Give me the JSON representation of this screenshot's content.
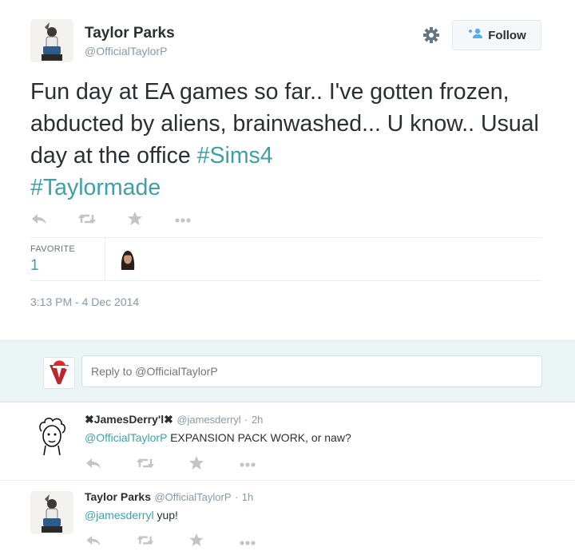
{
  "tweet": {
    "display_name": "Taylor Parks",
    "screen_name": "@OfficialTaylorP",
    "text_main": "Fun day at EA games so far.. I've gotten frozen, abducted by aliens, brainwashed... U know.. Usual day at the office ",
    "hashtag_1": "#Sims4",
    "hashtag_2": "#Taylormade",
    "follow_label": "Follow",
    "favorite_label": "FAVORITE",
    "favorite_count": "1",
    "timestamp": "3:13 PM - 4 Dec 2014"
  },
  "reply_box": {
    "placeholder": "Reply to @OfficialTaylorP"
  },
  "replies": [
    {
      "name": "✖JamesDerry'l✖",
      "handle": "@jamesderryl",
      "sep": "·",
      "time": "2h",
      "mention": "@OfficialTaylorP",
      "text": " EXPANSION PACK WORK, or naw?"
    },
    {
      "name": "Taylor Parks",
      "handle": "@OfficialTaylorP",
      "sep": "·",
      "time": "1h",
      "mention": "@jamesderryl",
      "text": " yup!"
    }
  ],
  "colors": {
    "link": "#3f9fa6",
    "secondary_text": "#8899a6",
    "primary_text": "#292f33",
    "reply_zone_bg": "#ecf5f5"
  },
  "icons": [
    "gear-icon",
    "follow-user-icon",
    "reply-icon",
    "retweet-icon",
    "favorite-star-icon",
    "more-icon"
  ]
}
